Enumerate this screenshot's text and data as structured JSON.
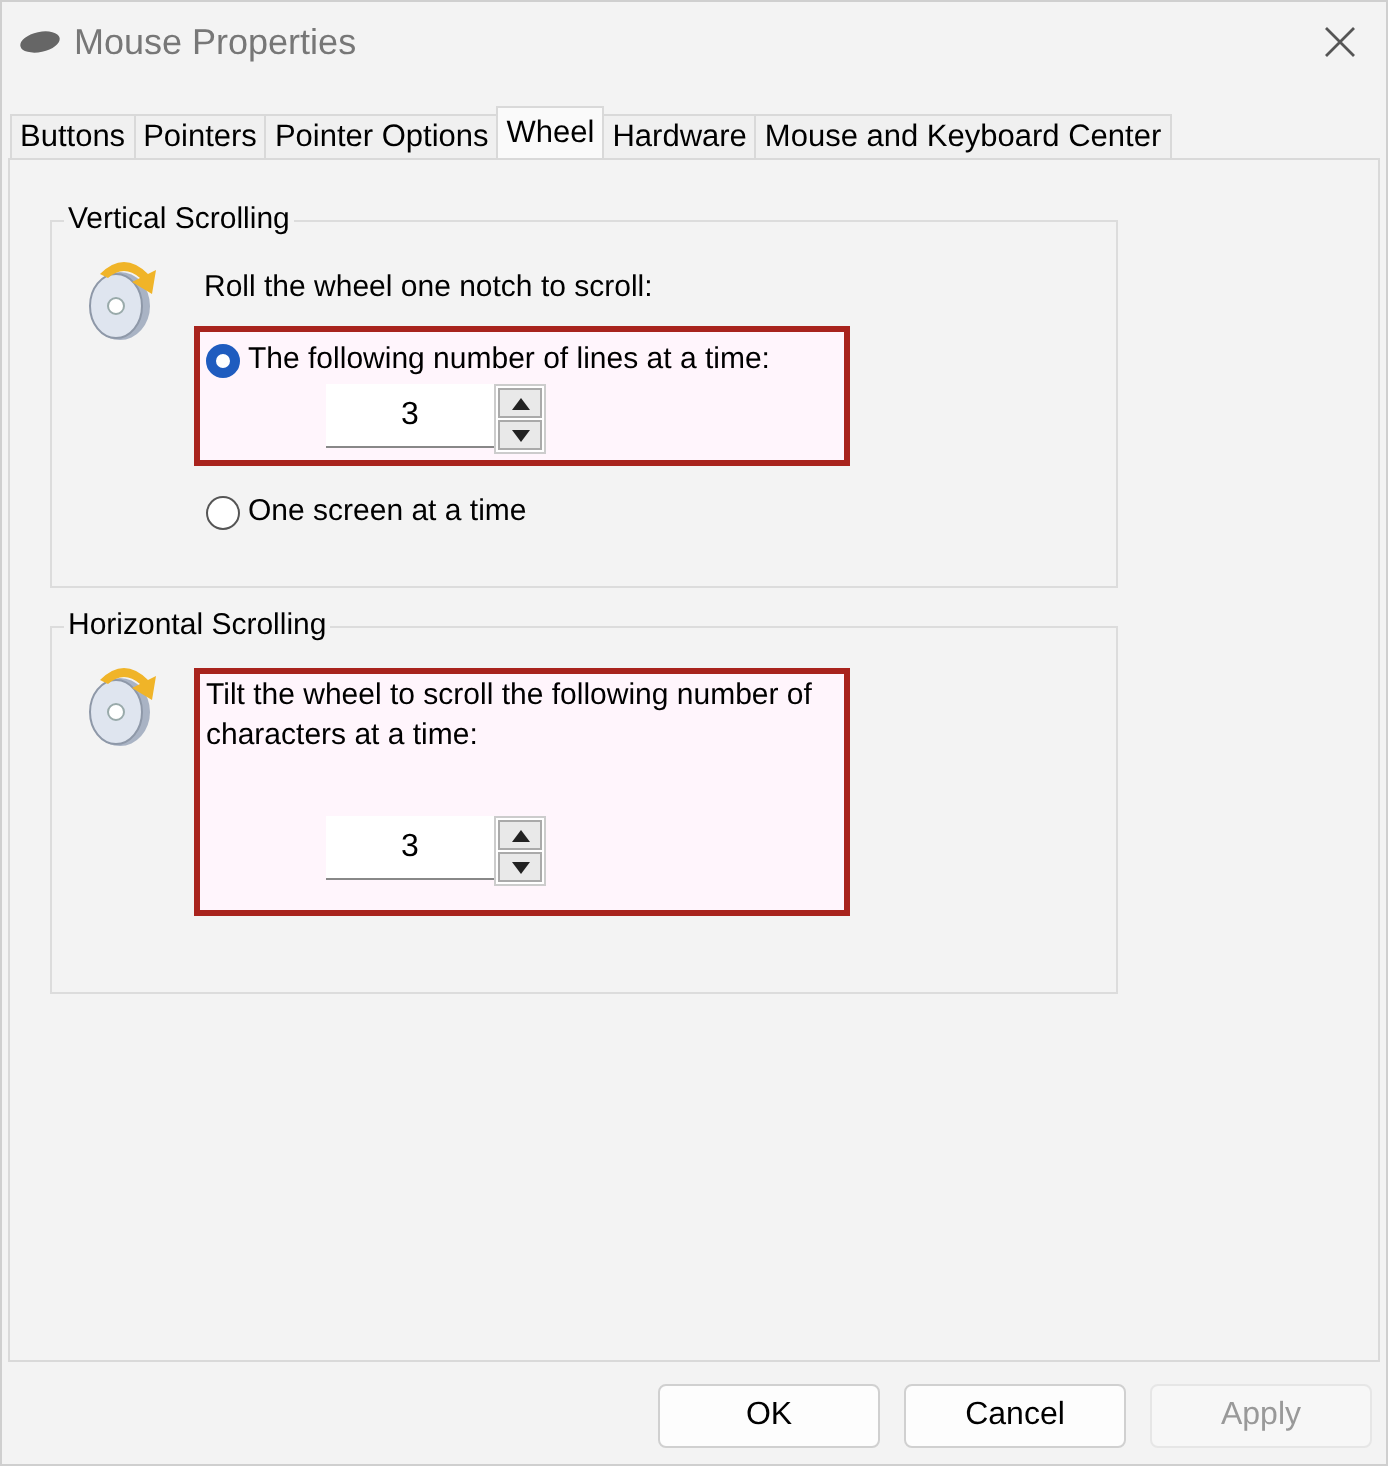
{
  "window": {
    "title": "Mouse Properties"
  },
  "tabs": [
    {
      "label": "Buttons",
      "selected": false
    },
    {
      "label": "Pointers",
      "selected": false
    },
    {
      "label": "Pointer Options",
      "selected": false
    },
    {
      "label": "Wheel",
      "selected": true
    },
    {
      "label": "Hardware",
      "selected": false
    },
    {
      "label": "Mouse and Keyboard Center",
      "selected": false
    }
  ],
  "vertical_scrolling": {
    "title": "Vertical Scrolling",
    "prompt": "Roll the wheel one notch to scroll:",
    "options": [
      {
        "label": "The following number of lines at a time:",
        "selected": true,
        "highlighted": true,
        "spin_value": "3"
      },
      {
        "label": "One screen at a time",
        "selected": false,
        "highlighted": false
      }
    ]
  },
  "horizontal_scrolling": {
    "title": "Horizontal Scrolling",
    "prompt": "Tilt the wheel to scroll the following number of characters at a time:",
    "highlighted": true,
    "spin_value": "3"
  },
  "buttons": [
    {
      "label": "OK",
      "disabled": false
    },
    {
      "label": "Cancel",
      "disabled": false
    },
    {
      "label": "Apply",
      "disabled": true
    }
  ]
}
